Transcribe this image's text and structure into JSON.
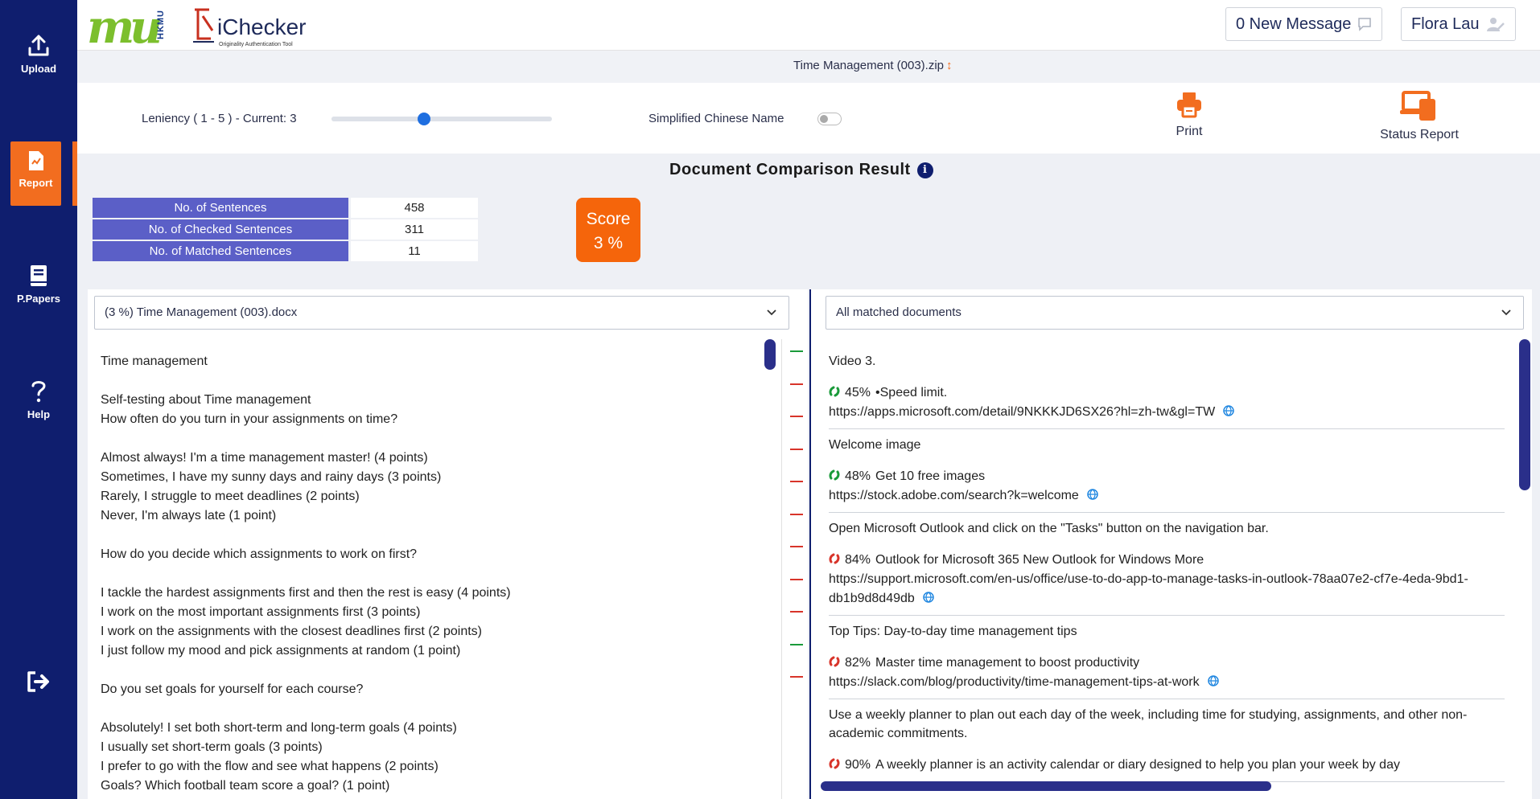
{
  "sidebar": {
    "items": [
      {
        "label": "Upload",
        "icon": "upload-icon"
      },
      {
        "label": "Report",
        "icon": "report-icon",
        "active": true
      },
      {
        "label": "P.Papers",
        "icon": "book-icon"
      },
      {
        "label": "Help",
        "icon": "help-icon"
      }
    ],
    "logout_icon": "logout-icon"
  },
  "header": {
    "logo_text": "mu",
    "logo_side": "HKMU",
    "app_name": "iChecker",
    "app_tagline": "Originality Authentication Tool",
    "messages_label": "0 New Message",
    "user_name": "Flora Lau"
  },
  "file": {
    "name": "Time Management (003).zip",
    "sort_icon": "↕"
  },
  "controls": {
    "leniency_label": "Leniency ( 1 - 5 ) - Current: 3",
    "leniency_value": 3,
    "leniency_min": 1,
    "leniency_max": 5,
    "simplified_chinese_label": "Simplified Chinese Name",
    "simplified_chinese_on": false,
    "print_label": "Print",
    "status_report_label": "Status Report"
  },
  "result": {
    "title": "Document Comparison Result",
    "info_glyph": "i",
    "stats": [
      {
        "label": "No. of Sentences",
        "value": "458"
      },
      {
        "label": "No. of Checked Sentences",
        "value": "311"
      },
      {
        "label": "No. of Matched Sentences",
        "value": "11"
      }
    ],
    "score_label": "Score",
    "score_value": "3 %"
  },
  "left_panel": {
    "selected_doc": "(3 %) Time Management (003).docx",
    "lines": [
      "Time management",
      "",
      "Self-testing about Time management",
      "How often do you turn in your assignments on time?",
      "",
      "Almost always! I'm a time management master! (4 points)",
      "Sometimes, I have my sunny days and rainy days (3 points)",
      "Rarely, I struggle to meet deadlines (2 points)",
      "Never, I'm always late (1 point)",
      "",
      "How do you decide which assignments to work on first?",
      "",
      "I tackle the hardest assignments first and then the rest is easy (4 points)",
      "I work on the most important assignments first (3 points)",
      "I work on the assignments with the closest deadlines first (2 points)",
      "I just follow my mood and pick assignments at random (1 point)",
      "",
      "Do you set goals for yourself for each course?",
      "",
      "Absolutely! I set both short-term and long-term goals (4 points)",
      "I usually set short-term goals (3 points)",
      "I prefer to go with the flow and see what happens (2 points)",
      "Goals? Which football team score a goal? (1 point)"
    ],
    "marks": [
      {
        "color": "#1a9a3a"
      },
      {
        "color": "#d8342a"
      },
      {
        "color": "#d8342a"
      },
      {
        "color": "#d8342a"
      },
      {
        "color": "#d8342a"
      },
      {
        "color": "#d8342a"
      },
      {
        "color": "#d8342a"
      },
      {
        "color": "#d8342a"
      },
      {
        "color": "#d8342a"
      },
      {
        "color": "#1a9a3a"
      },
      {
        "color": "#d8342a"
      }
    ]
  },
  "right_panel": {
    "selected_filter": "All matched documents",
    "matches": [
      {
        "sentence": "Video 3.",
        "percent": "45%",
        "title": "•Speed limit.",
        "url": "https://apps.microsoft.com/detail/9NKKKJD6SX26?hl=zh-tw&gl=TW",
        "level": "low"
      },
      {
        "sentence": "Welcome image",
        "percent": "48%",
        "title": "Get 10 free images",
        "url": "https://stock.adobe.com/search?k=welcome",
        "level": "low"
      },
      {
        "sentence": "Open Microsoft Outlook and click on the \"Tasks\" button on the navigation bar.",
        "percent": "84%",
        "title": "Outlook for Microsoft 365 New Outlook for Windows More",
        "url": "https://support.microsoft.com/en-us/office/use-to-do-app-to-manage-tasks-in-outlook-78aa07e2-cf7e-4eda-9bd1-db1b9d8d49db",
        "level": "high"
      },
      {
        "sentence": "Top Tips: Day-to-day time management tips",
        "percent": "82%",
        "title": "Master time management to boost productivity",
        "url": "https://slack.com/blog/productivity/time-management-tips-at-work",
        "level": "high"
      },
      {
        "sentence": "Use a weekly planner to plan out each day of the week, including time for studying, assignments, and other non-academic commitments.",
        "percent": "90%",
        "title": "A weekly planner is an activity calendar or diary designed to help you plan your week by day",
        "url": "",
        "level": "high"
      }
    ]
  },
  "colors": {
    "sidebar": "#0f1e6e",
    "accent": "#f26d1f",
    "stat_label_bg": "#5b5fc7",
    "low_match": "#1a9a3a",
    "high_match": "#d8342a",
    "link": "#1f86e0"
  }
}
